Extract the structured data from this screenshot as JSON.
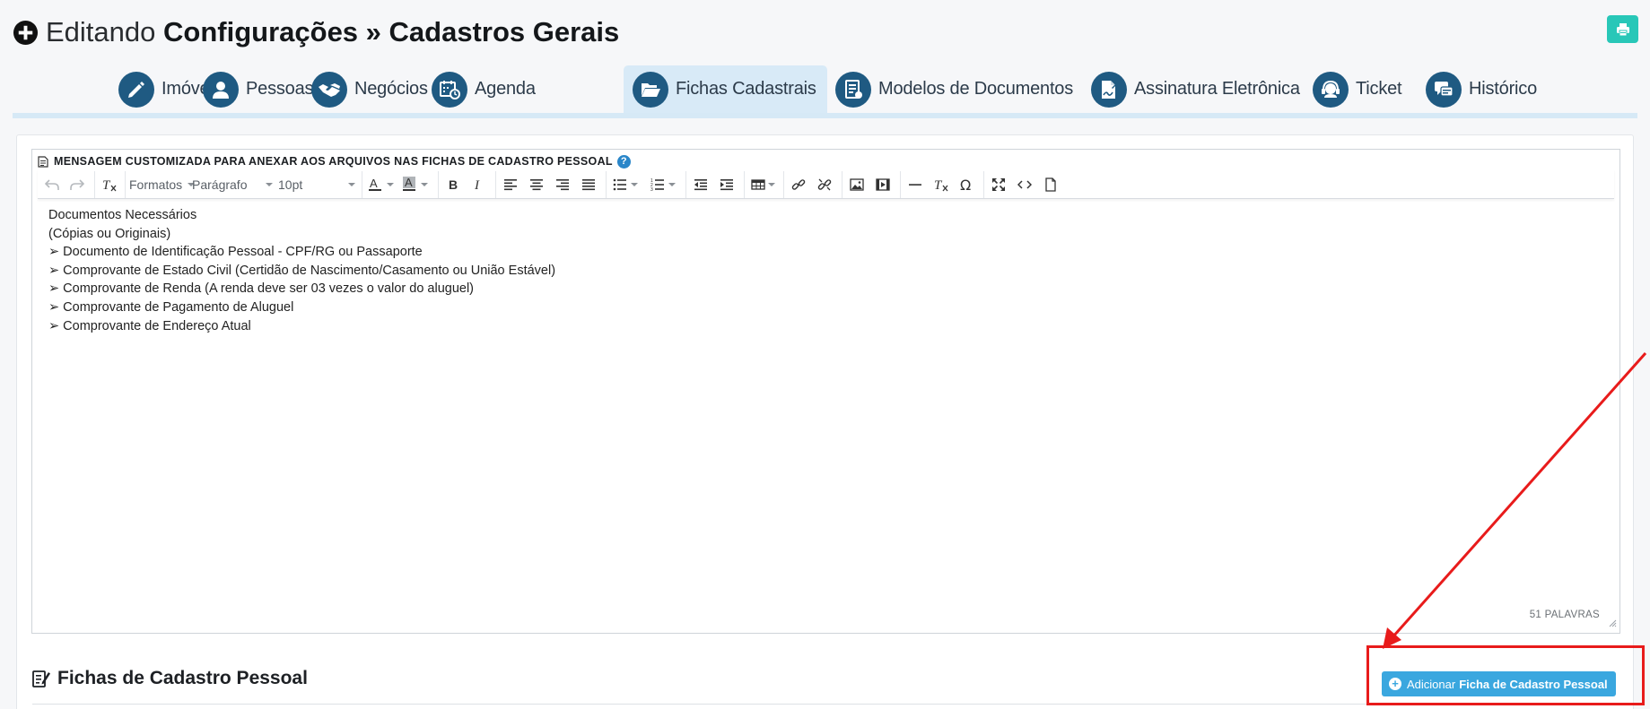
{
  "header": {
    "title_prefix": "Editando",
    "title_main": "Configurações » Cadastros Gerais"
  },
  "tabs": [
    {
      "label": "Imóvel",
      "icon": "pencil-icon"
    },
    {
      "label": "Pessoas",
      "icon": "user-icon"
    },
    {
      "label": "Negócios",
      "icon": "handshake-icon"
    },
    {
      "label": "Agenda",
      "icon": "calendar-clock-icon"
    },
    {
      "label": "Fichas Cadastrais",
      "icon": "folder-open-icon",
      "active": true
    },
    {
      "label": "Modelos de Documentos",
      "icon": "document-list-icon"
    },
    {
      "label": "Assinatura Eletrônica",
      "icon": "signature-icon"
    },
    {
      "label": "Ticket",
      "icon": "headset-icon"
    },
    {
      "label": "Histórico",
      "icon": "chat-history-icon"
    }
  ],
  "editor": {
    "label": "MENSAGEM CUSTOMIZADA PARA ANEXAR AOS ARQUIVOS NAS FICHAS DE CADASTRO PESSOAL",
    "toolbar": {
      "formats": "Formatos",
      "paragraph": "Parágrafo",
      "font_size": "10pt"
    },
    "lines": [
      "Documentos Necessários",
      "(Cópias ou Originais)",
      "➢ Documento de Identificação Pessoal - CPF/RG ou Passaporte",
      "➢ Comprovante de Estado Civil (Certidão de Nascimento/Casamento ou União Estável)",
      "➢ Comprovante de Renda (A renda deve ser 03 vezes o valor do aluguel)",
      "➢ Comprovante de Pagamento de Aluguel",
      "➢ Comprovante de Endereço Atual"
    ],
    "word_count": "51 PALAVRAS"
  },
  "section": {
    "title": "Fichas de Cadastro Pessoal",
    "add_button_prefix": "Adicionar",
    "add_button_bold": "Ficha de Cadastro Pessoal"
  },
  "colors": {
    "accent": "#1f5a82",
    "tab_active_bg": "#d8eaf7",
    "print_button": "#28c7b8",
    "add_button": "#3aa7df",
    "annotation": "#e81b1b"
  }
}
